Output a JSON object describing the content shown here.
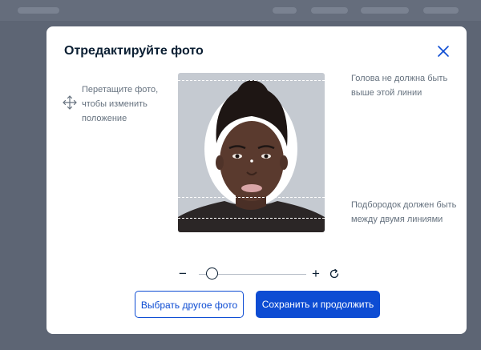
{
  "dialog": {
    "title": "Отредактируйте фото",
    "drag_hint": "Перетащите фото, чтобы изменить положение",
    "top_hint": "Голова не должна быть выше этой линии",
    "chin_hint": "Подбородок должен быть между двумя линиями",
    "zoom": {
      "minus": "−",
      "plus": "+",
      "level": 0.12
    },
    "buttons": {
      "choose_other": "Выбрать другое фото",
      "save_continue": "Сохранить и продолжить"
    }
  },
  "colors": {
    "accent": "#0d4cd3",
    "title": "#0b1f33",
    "hint": "#66727f",
    "overlay": "#5d6574"
  },
  "icons": [
    "close-icon",
    "move-icon",
    "reset-icon"
  ]
}
